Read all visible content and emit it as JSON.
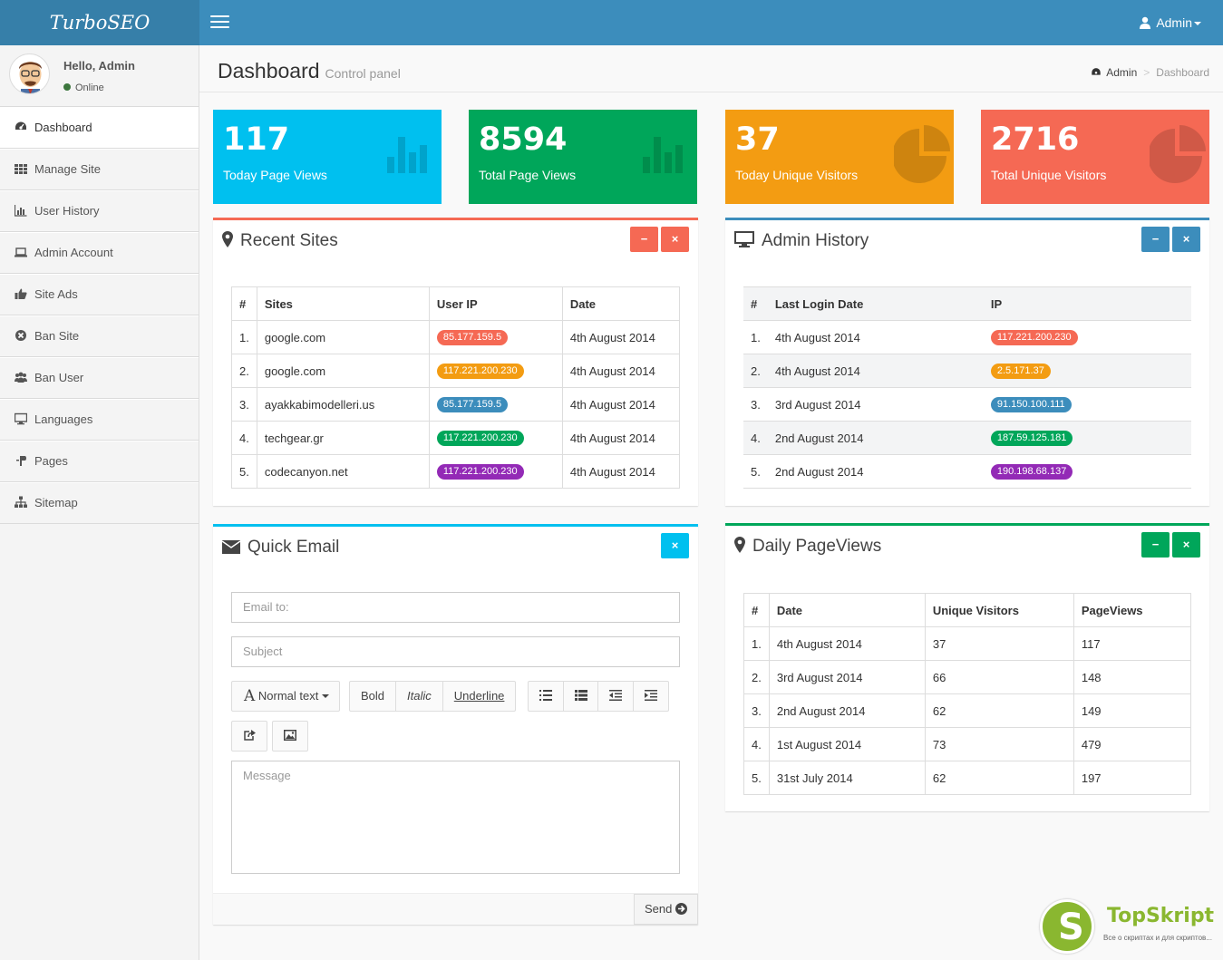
{
  "app": {
    "logo": "TurboSEO"
  },
  "header": {
    "user_label": "Admin"
  },
  "user_panel": {
    "greeting": "Hello, Admin",
    "status": "Online"
  },
  "sidebar": {
    "items": [
      {
        "label": "Dashboard",
        "icon": "dashboard-icon",
        "active": true
      },
      {
        "label": "Manage Site",
        "icon": "grid-icon"
      },
      {
        "label": "User History",
        "icon": "bar-chart-icon"
      },
      {
        "label": "Admin Account",
        "icon": "laptop-icon"
      },
      {
        "label": "Site Ads",
        "icon": "thumbs-up-icon"
      },
      {
        "label": "Ban Site",
        "icon": "ban-circle-icon"
      },
      {
        "label": "Ban User",
        "icon": "users-icon"
      },
      {
        "label": "Languages",
        "icon": "desktop-icon"
      },
      {
        "label": "Pages",
        "icon": "paragraph-icon"
      },
      {
        "label": "Sitemap",
        "icon": "sitemap-icon"
      }
    ]
  },
  "page": {
    "title": "Dashboard",
    "subtitle": "Control panel",
    "breadcrumb": {
      "home": "Admin",
      "current": "Dashboard"
    }
  },
  "stats": [
    {
      "value": "117",
      "label": "Today Page Views",
      "color": "#00c0ef",
      "icon": "bar-chart-icon"
    },
    {
      "value": "8594",
      "label": "Total Page Views",
      "color": "#00a65a",
      "icon": "bar-chart-icon"
    },
    {
      "value": "37",
      "label": "Today Unique Visitors",
      "color": "#f39c12",
      "icon": "pie-chart-icon"
    },
    {
      "value": "2716",
      "label": "Total Unique Visitors",
      "color": "#f56954",
      "icon": "pie-chart-icon"
    }
  ],
  "recent_sites": {
    "title": "Recent Sites",
    "columns": [
      "#",
      "Sites",
      "User IP",
      "Date"
    ],
    "rows": [
      {
        "n": "1.",
        "site": "google.com",
        "ip": "85.177.159.5",
        "ip_color": "#f56954",
        "date": "4th August 2014"
      },
      {
        "n": "2.",
        "site": "google.com",
        "ip": "117.221.200.230",
        "ip_color": "#f39c12",
        "date": "4th August 2014"
      },
      {
        "n": "3.",
        "site": "ayakkabimodelleri.us",
        "ip": "85.177.159.5",
        "ip_color": "#3c8dbc",
        "date": "4th August 2014"
      },
      {
        "n": "4.",
        "site": "techgear.gr",
        "ip": "117.221.200.230",
        "ip_color": "#00a65a",
        "date": "4th August 2014"
      },
      {
        "n": "5.",
        "site": "codecanyon.net",
        "ip": "117.221.200.230",
        "ip_color": "#932ab6",
        "date": "4th August 2014"
      }
    ]
  },
  "admin_history": {
    "title": "Admin History",
    "columns": [
      "#",
      "Last Login Date",
      "IP"
    ],
    "rows": [
      {
        "n": "1.",
        "date": "4th August 2014",
        "ip": "117.221.200.230",
        "ip_color": "#f56954"
      },
      {
        "n": "2.",
        "date": "4th August 2014",
        "ip": "2.5.171.37",
        "ip_color": "#f39c12"
      },
      {
        "n": "3.",
        "date": "3rd August 2014",
        "ip": "91.150.100.111",
        "ip_color": "#3c8dbc"
      },
      {
        "n": "4.",
        "date": "2nd August 2014",
        "ip": "187.59.125.181",
        "ip_color": "#00a65a"
      },
      {
        "n": "5.",
        "date": "2nd August 2014",
        "ip": "190.198.68.137",
        "ip_color": "#932ab6"
      }
    ]
  },
  "quick_email": {
    "title": "Quick Email",
    "email_placeholder": "Email to:",
    "subject_placeholder": "Subject",
    "message_placeholder": "Message",
    "toolbar": {
      "font_style": "Normal text",
      "bold": "Bold",
      "italic": "Italic",
      "underline": "Underline"
    },
    "send_label": "Send"
  },
  "daily_pageviews": {
    "title": "Daily PageViews",
    "columns": [
      "#",
      "Date",
      "Unique Visitors",
      "PageViews"
    ],
    "rows": [
      {
        "n": "1.",
        "date": "4th August 2014",
        "visitors": "37",
        "views": "117"
      },
      {
        "n": "2.",
        "date": "3rd August 2014",
        "visitors": "66",
        "views": "148"
      },
      {
        "n": "3.",
        "date": "2nd August 2014",
        "visitors": "62",
        "views": "149"
      },
      {
        "n": "4.",
        "date": "1st August 2014",
        "visitors": "73",
        "views": "479"
      },
      {
        "n": "5.",
        "date": "31st July 2014",
        "visitors": "62",
        "views": "197"
      }
    ]
  },
  "watermark": {
    "title": "TopSkript",
    "tagline": "Все о скриптах и для скриптов...",
    "letter": "S"
  }
}
